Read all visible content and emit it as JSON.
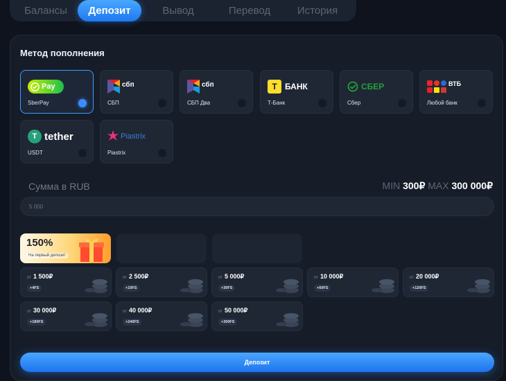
{
  "tabs": [
    {
      "label": "Балансы"
    },
    {
      "label": "Депозит"
    },
    {
      "label": "Вывод"
    },
    {
      "label": "Перевод"
    },
    {
      "label": "История"
    }
  ],
  "deposit": {
    "title": "Метод пополнения",
    "methods": [
      {
        "label": "SberPay",
        "logo_text": "Pay"
      },
      {
        "label": "СБП",
        "logo_text": "сбп"
      },
      {
        "label": "СБП Два",
        "logo_text": "сбп"
      },
      {
        "label": "Т-Банк",
        "logo_text": "БАНК",
        "logo_mark": "Т"
      },
      {
        "label": "Сбер",
        "logo_text": "СБЕР"
      },
      {
        "label": "Любой банк",
        "logo_text": "ВТБ"
      },
      {
        "label": "USDT",
        "logo_text": "tether",
        "logo_mark": "T"
      },
      {
        "label": "Piastrix",
        "logo_text": "Piastrix"
      }
    ],
    "sum_label": "Сумма в RUB",
    "min_label": "MIN",
    "min_value": "300₽",
    "max_label": "MAX",
    "max_value": "300 000₽",
    "amount_placeholder": "5 000",
    "bonus": {
      "percent": "150%",
      "subtitle": "На первый депозит"
    },
    "presets_prefix": "от",
    "presets": [
      {
        "amount": "1 500₽",
        "fs": "+4FS"
      },
      {
        "amount": "2 500₽",
        "fs": "+10FS"
      },
      {
        "amount": "5 000₽",
        "fs": "+30FS"
      },
      {
        "amount": "10 000₽",
        "fs": "+60FS"
      },
      {
        "amount": "20 000₽",
        "fs": "+120FS"
      },
      {
        "amount": "30 000₽",
        "fs": "+180FS"
      },
      {
        "amount": "40 000₽",
        "fs": "+240FS"
      },
      {
        "amount": "50 000₽",
        "fs": "+300FS"
      }
    ],
    "submit_label": "Депозит"
  },
  "colors": {
    "accent": "#2f8cff",
    "panel": "#161d29",
    "card": "#1f2735",
    "sber_green": "#21a038",
    "tether_green": "#26a17b"
  }
}
